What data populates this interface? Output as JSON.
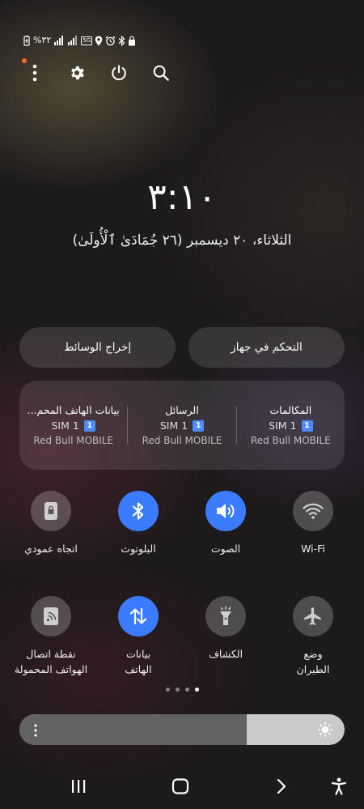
{
  "status_bar": {
    "battery_percent": "%٣٢",
    "network_badge": "5G",
    "icons": [
      "battery-saver-icon",
      "signal-sim1-icon",
      "signal-sim2-icon",
      "5g-icon",
      "location-icon",
      "alarm-icon",
      "bluetooth-icon",
      "lock-icon"
    ]
  },
  "top_actions": {
    "icons": [
      "more-options-icon",
      "settings-icon",
      "power-icon",
      "search-icon"
    ]
  },
  "clock": {
    "time": "٣:١٠",
    "date": "الثلاثاء، ٢٠ ديسمبر (٢٦ جُمَادَىٰ ٱلْأُولَىٰ)"
  },
  "pills": {
    "device_control": "التحكم في جهاز",
    "media_output": "إخراج الوسائط"
  },
  "sim_panel": [
    {
      "title": "المكالمات",
      "sim": "SIM 1",
      "badge": "1",
      "carrier": "Red Bull MOBILE"
    },
    {
      "title": "الرسائل",
      "sim": "SIM 1",
      "badge": "1",
      "carrier": "Red Bull MOBILE"
    },
    {
      "title": "بيانات الهاتف المحم...",
      "sim": "SIM 1",
      "badge": "1",
      "carrier": "Red Bull MOBILE"
    }
  ],
  "tiles": [
    {
      "label": "Wi-Fi",
      "icon": "wifi-icon",
      "state": "off"
    },
    {
      "label": "الصوت",
      "icon": "sound-icon",
      "state": "on"
    },
    {
      "label": "البلوتوث",
      "icon": "bluetooth-icon",
      "state": "on"
    },
    {
      "label": "اتجاه عمودي",
      "icon": "portrait-lock-icon",
      "state": "off"
    },
    {
      "label": "وضع\nالطيران",
      "icon": "airplane-icon",
      "state": "off"
    },
    {
      "label": "الكشاف",
      "icon": "flashlight-icon",
      "state": "off"
    },
    {
      "label": "بيانات\nالهاتف",
      "icon": "mobile-data-icon",
      "state": "on"
    },
    {
      "label": "نقطة اتصال\nالهواتف المحمولة",
      "icon": "hotspot-icon",
      "state": "off"
    }
  ],
  "pager": {
    "pages": 4,
    "active_index": 3
  },
  "brightness": {
    "level_fraction": 0.7
  },
  "nav_bar": {
    "icons": [
      "recents-icon",
      "home-icon",
      "back-icon",
      "accessibility-icon"
    ]
  },
  "colors": {
    "accent": "#3b7bff",
    "notification_dot": "#ff6a1f",
    "sim_badge": "#4a8cff"
  }
}
